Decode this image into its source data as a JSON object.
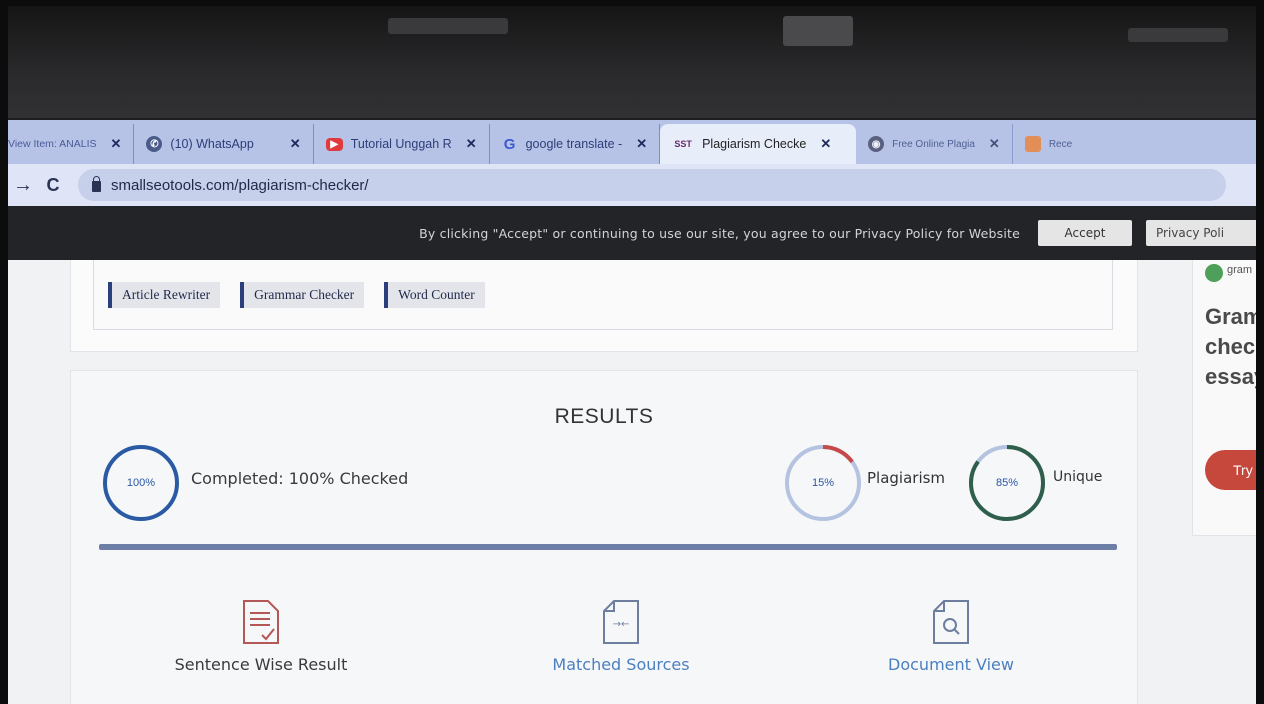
{
  "tabs": [
    {
      "label": "View Item: ANALIS",
      "icon": "document-icon",
      "active": false
    },
    {
      "label": "(10) WhatsApp",
      "icon": "whatsapp-icon",
      "active": false
    },
    {
      "label": "Tutorial Unggah R",
      "icon": "youtube-icon",
      "active": false
    },
    {
      "label": "google translate -",
      "icon": "google-icon",
      "active": false
    },
    {
      "label": "Plagiarism Checke",
      "icon": "sst-icon",
      "active": true
    },
    {
      "label": "Free Online Plagia",
      "icon": "globe-icon",
      "active": false
    },
    {
      "label": "Rece",
      "icon": "orange-app-icon",
      "active": false
    }
  ],
  "address": {
    "url": "smallseotools.com/plagiarism-checker/"
  },
  "cookie": {
    "text": "By clicking \"Accept\" or continuing to use our site, you agree to our Privacy Policy for Website",
    "accept": "Accept",
    "privacy": "Privacy Poli"
  },
  "tools": [
    "Article Rewriter",
    "Grammar Checker",
    "Word Counter"
  ],
  "results": {
    "title": "RESULTS",
    "completed_pct": "100%",
    "completed_label": "Completed: 100% Checked",
    "plagiarism_pct": "15%",
    "plagiarism_label": "Plagiarism",
    "plagiarism_value": 0.15,
    "unique_pct": "85%",
    "unique_label": "Unique",
    "unique_value": 0.85
  },
  "actions": [
    {
      "label": "Sentence Wise Result",
      "icon": "sentence-report-icon"
    },
    {
      "label": "Matched Sources",
      "icon": "matched-sources-icon"
    },
    {
      "label": "Document View",
      "icon": "document-search-icon"
    }
  ],
  "side_ad": {
    "brand": "gram",
    "headline": [
      "Gramr",
      "check",
      "essay"
    ],
    "button": "Try"
  },
  "colors": {
    "tab_strip": "#b7c3e6",
    "ring_complete": "#2a5aa3",
    "ring_plagiarism": "#c74a4a",
    "ring_unique": "#2f5e4a",
    "try_button": "#c6473c"
  }
}
